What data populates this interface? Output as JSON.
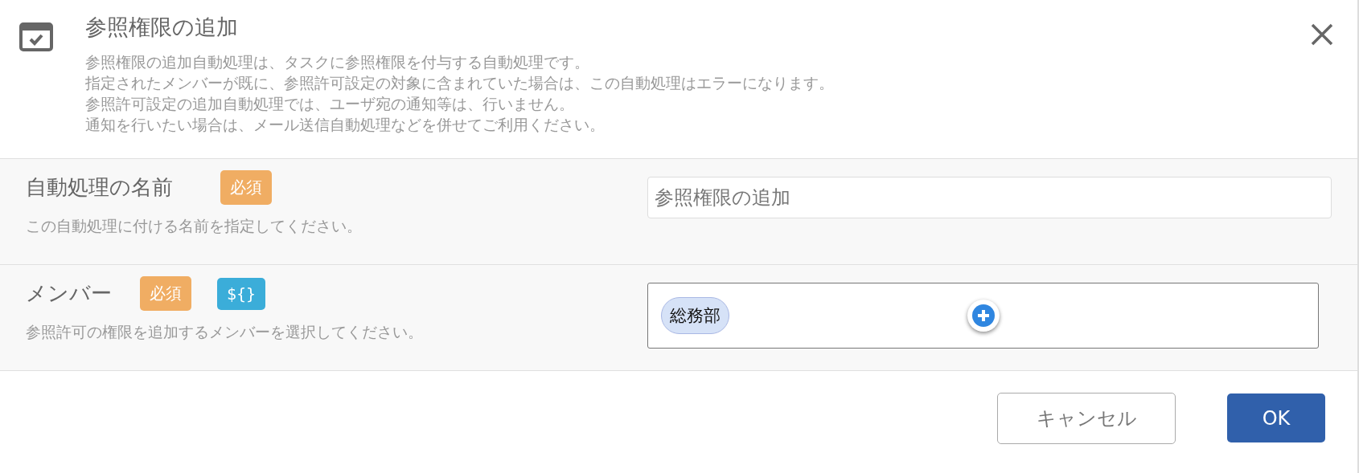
{
  "dialog": {
    "title": "参照権限の追加",
    "description": [
      "参照権限の追加自動処理は、タスクに参照権限を付与する自動処理です。",
      "指定されたメンバーが既に、参照許可設定の対象に含まれていた場合は、この自動処理はエラーになります。",
      "参照許可設定の追加自動処理では、ユーザ宛の通知等は、行いません。",
      "通知を行いたい場合は、メール送信自動処理などを併せてご利用ください。"
    ]
  },
  "fields": [
    {
      "label": "自動処理の名前",
      "badges": [
        {
          "kind": "required",
          "text": "必須"
        }
      ],
      "help": "この自動処理に付ける名前を指定してください。",
      "control": {
        "kind": "text",
        "value": "参照権限の追加"
      }
    },
    {
      "label": "メンバー",
      "badges": [
        {
          "kind": "required",
          "text": "必須"
        },
        {
          "kind": "variable",
          "text": "${}"
        }
      ],
      "help": "参照許可の権限を追加するメンバーを選択してください。",
      "control": {
        "kind": "members",
        "chips": [
          "総務部"
        ]
      }
    }
  ],
  "buttons": [
    {
      "kind": "secondary",
      "label": "キャンセル"
    },
    {
      "kind": "primary",
      "label": "OK"
    }
  ]
}
